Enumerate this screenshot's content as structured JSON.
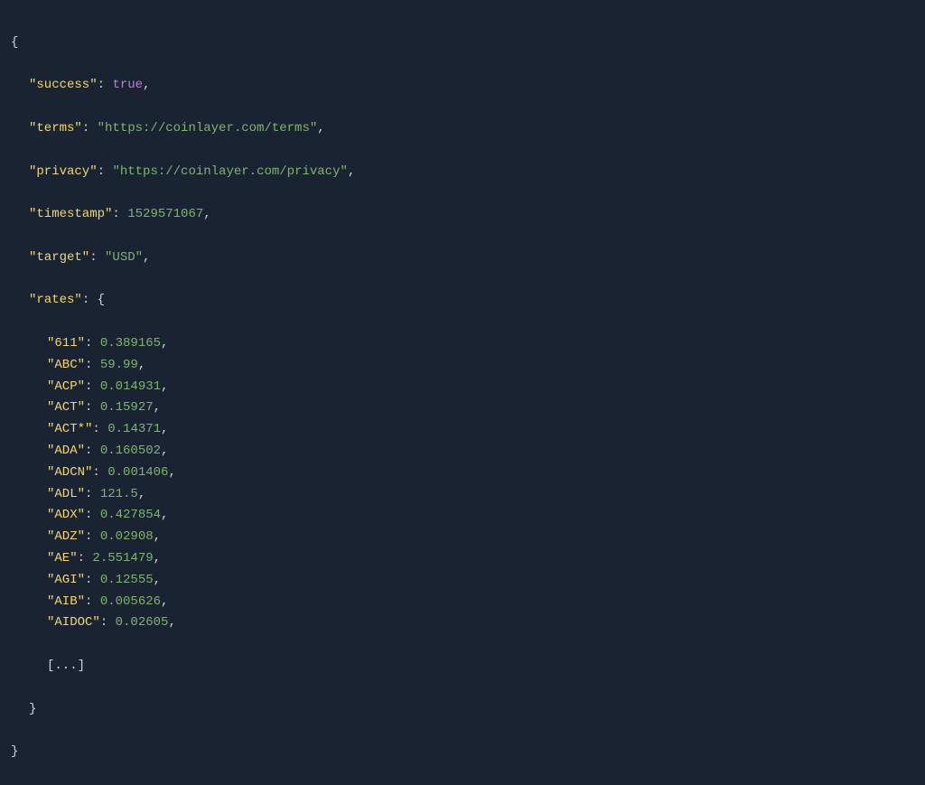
{
  "json": {
    "success_key": "\"success\"",
    "success_val": "true",
    "terms_key": "\"terms\"",
    "terms_val": "\"https://coinlayer.com/terms\"",
    "privacy_key": "\"privacy\"",
    "privacy_val": "\"https://coinlayer.com/privacy\"",
    "timestamp_key": "\"timestamp\"",
    "timestamp_val": "1529571067",
    "target_key": "\"target\"",
    "target_val": "\"USD\"",
    "rates_key": "\"rates\"",
    "rates": [
      {
        "key": "\"611\"",
        "val": "0.389165"
      },
      {
        "key": "\"ABC\"",
        "val": "59.99"
      },
      {
        "key": "\"ACP\"",
        "val": "0.014931"
      },
      {
        "key": "\"ACT\"",
        "val": "0.15927"
      },
      {
        "key": "\"ACT*\"",
        "val": "0.14371"
      },
      {
        "key": "\"ADA\"",
        "val": "0.160502"
      },
      {
        "key": "\"ADCN\"",
        "val": "0.001406"
      },
      {
        "key": "\"ADL\"",
        "val": "121.5"
      },
      {
        "key": "\"ADX\"",
        "val": "0.427854"
      },
      {
        "key": "\"ADZ\"",
        "val": "0.02908"
      },
      {
        "key": "\"AE\"",
        "val": "2.551479"
      },
      {
        "key": "\"AGI\"",
        "val": "0.12555"
      },
      {
        "key": "\"AIB\"",
        "val": "0.005626"
      },
      {
        "key": "\"AIDOC\"",
        "val": "0.02605"
      }
    ],
    "ellipsis": "[...]"
  }
}
